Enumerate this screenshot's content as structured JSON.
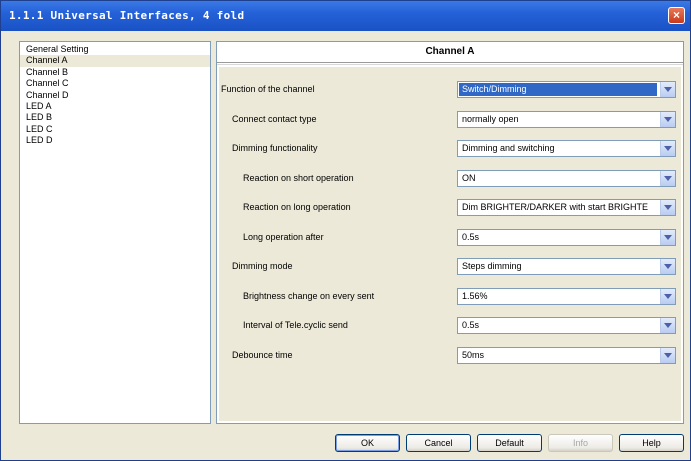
{
  "window": {
    "title": "1.1.1 Universal Interfaces, 4 fold",
    "close_glyph": "×"
  },
  "tree": {
    "items": [
      "General Setting",
      "Channel A",
      "Channel B",
      "Channel C",
      "Channel D",
      "LED A",
      "LED B",
      "LED C",
      "LED D"
    ],
    "selected": "Channel A"
  },
  "panel": {
    "title": "Channel A",
    "params": [
      {
        "label": "Function of the channel",
        "value": "Switch/Dimming"
      },
      {
        "label": "Connect contact type",
        "value": "normally open"
      },
      {
        "label": "Dimming functionality",
        "value": "Dimming and switching"
      },
      {
        "label": "Reaction on short operation",
        "value": "ON"
      },
      {
        "label": "Reaction on long operation",
        "value": "Dim BRIGHTER/DARKER with start BRIGHTE"
      },
      {
        "label": "Long operation after",
        "value": "0.5s"
      },
      {
        "label": "Dimming mode",
        "value": "Steps dimming"
      },
      {
        "label": "Brightness change on every sent",
        "value": "1.56%"
      },
      {
        "label": "Interval of Tele.cyclic send",
        "value": "0.5s"
      },
      {
        "label": "Debounce time",
        "value": "50ms"
      }
    ]
  },
  "buttons": {
    "ok": "OK",
    "cancel": "Cancel",
    "default": "Default",
    "info": "Info",
    "help": "Help"
  },
  "colors": {
    "titlebar": "#2461d8",
    "selection": "#3168c6",
    "dialog": "#ece9d8"
  }
}
